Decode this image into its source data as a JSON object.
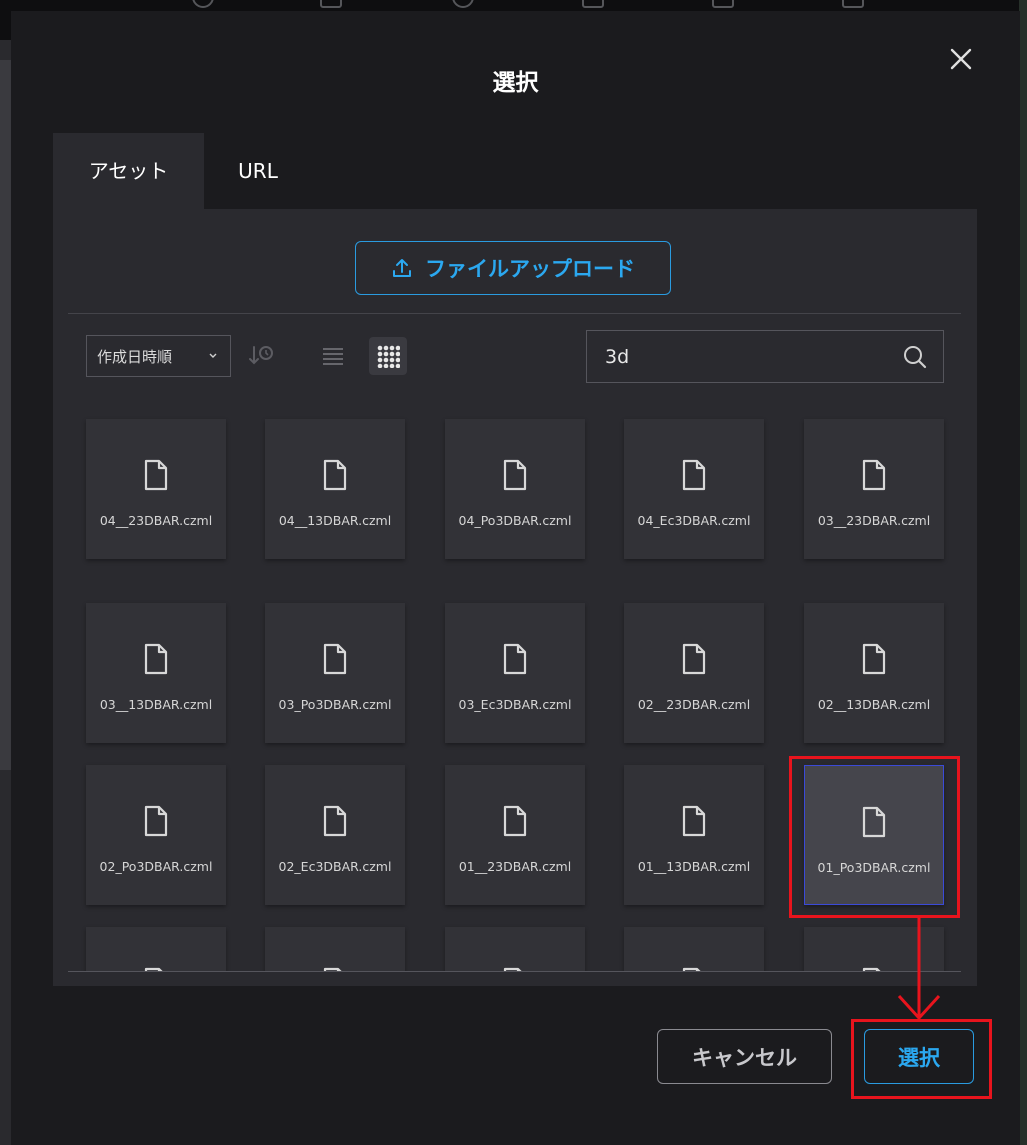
{
  "dialog": {
    "title": "選択",
    "tabs": [
      {
        "label": "アセット",
        "active": true
      },
      {
        "label": "URL",
        "active": false
      }
    ],
    "upload_label": "ファイルアップロード",
    "sort_label": "作成日時順",
    "search": {
      "value": "3d",
      "placeholder": ""
    },
    "view_mode": "grid",
    "files": [
      {
        "name": "04__23DBAR.czml"
      },
      {
        "name": "04__13DBAR.czml"
      },
      {
        "name": "04_Po3DBAR.czml"
      },
      {
        "name": "04_Ec3DBAR.czml"
      },
      {
        "name": "03__23DBAR.czml"
      },
      {
        "name": "03__13DBAR.czml"
      },
      {
        "name": "03_Po3DBAR.czml"
      },
      {
        "name": "03_Ec3DBAR.czml"
      },
      {
        "name": "02__23DBAR.czml"
      },
      {
        "name": "02__13DBAR.czml"
      },
      {
        "name": "02_Po3DBAR.czml"
      },
      {
        "name": "02_Ec3DBAR.czml"
      },
      {
        "name": "01__23DBAR.czml"
      },
      {
        "name": "01__13DBAR.czml"
      },
      {
        "name": "01_Po3DBAR.czml",
        "selected": true
      }
    ],
    "partial_row_count": 5,
    "cancel_label": "キャンセル",
    "select_label": "選択"
  },
  "colors": {
    "accent": "#2ba8f0",
    "highlight": "#e8141d",
    "selection_border": "#3b4ad8",
    "modal_bg": "#1b1b1e",
    "panel_bg": "#2a2a2f"
  },
  "icons": [
    "close-icon",
    "upload-icon",
    "chevron-down-icon",
    "sort-order-icon",
    "list-view-icon",
    "grid-view-icon",
    "search-icon",
    "file-icon"
  ]
}
